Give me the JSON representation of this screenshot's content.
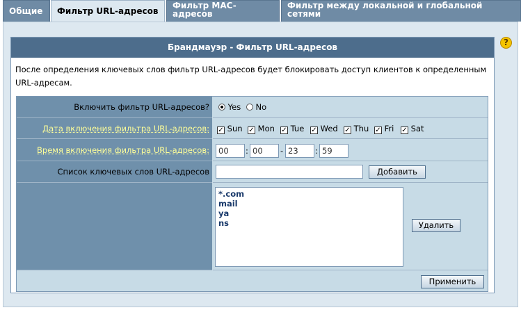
{
  "tabs": [
    {
      "lines": [
        "Общие"
      ],
      "active": false
    },
    {
      "lines": [
        "Фильтр URL-адресов"
      ],
      "active": true
    },
    {
      "lines": [
        "Фильтр MAC-",
        "адресов"
      ],
      "active": false
    },
    {
      "lines": [
        "Фильтр между локальной и глобальной",
        "сетями"
      ],
      "active": false
    }
  ],
  "title": "Брандмауэр - Фильтр URL-адресов",
  "description": "После определения ключевых слов фильтр URL-адресов будет блокировать доступ клиентов к определенным URL-адресам.",
  "help_icon": "?",
  "form": {
    "enable_label": "Включить фильтр URL-адресов?",
    "yes_label": "Yes",
    "no_label": "No",
    "enabled": "Yes",
    "date_label": "Дата включения фильтра URL-адресов:",
    "days": [
      {
        "label": "Sun",
        "checked": true
      },
      {
        "label": "Mon",
        "checked": true
      },
      {
        "label": "Tue",
        "checked": true
      },
      {
        "label": "Wed",
        "checked": true
      },
      {
        "label": "Thu",
        "checked": true
      },
      {
        "label": "Fri",
        "checked": true
      },
      {
        "label": "Sat",
        "checked": true
      }
    ],
    "time_label": "Время включения фильтра URL-адресов:",
    "time_start_hour": "00",
    "time_start_min": "00",
    "time_end_hour": "23",
    "time_end_min": "59",
    "time_sep_colon": ":",
    "time_sep_dash": "-",
    "keyword_label": "Список ключевых слов URL-адресов",
    "keyword_value": "",
    "add_button": "Добавить",
    "keywords": [
      "*.com",
      "mail",
      "ya",
      "ns"
    ],
    "delete_button": "Удалить",
    "apply_button": "Применить"
  },
  "colors": {
    "header": "#4d6d8c",
    "label_bg": "#6f90ab",
    "panel": "#c7dbe6",
    "hint_text": "#ffff99"
  }
}
